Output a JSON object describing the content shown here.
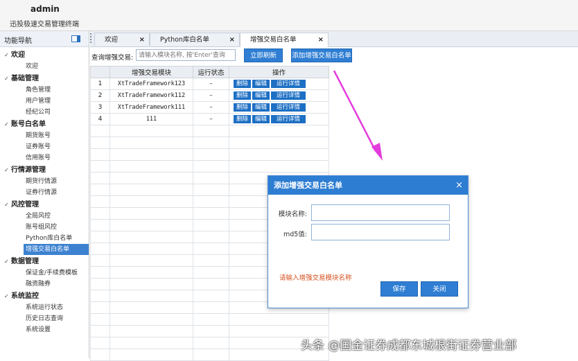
{
  "header": {
    "user": "admin",
    "system_name": "迅投极速交易管理终端"
  },
  "sidebar": {
    "title": "功能导航",
    "groups": [
      {
        "label": "欢迎",
        "items": [
          "欢迎"
        ]
      },
      {
        "label": "基础管理",
        "items": [
          "角色管理",
          "用户管理",
          "经纪公司"
        ]
      },
      {
        "label": "账号白名单",
        "items": [
          "期货账号",
          "证券账号",
          "信用账号"
        ]
      },
      {
        "label": "行情源管理",
        "items": [
          "期货行情源",
          "证券行情源"
        ]
      },
      {
        "label": "风控管理",
        "items": [
          "全局风控",
          "账号组风控",
          "Python库白名单",
          "增强交易白名单"
        ]
      },
      {
        "label": "数据管理",
        "items": [
          "保证金/手续费模板",
          "融资融券"
        ]
      },
      {
        "label": "系统监控",
        "items": [
          "系统运行状态",
          "历史日志查询",
          "系统设置"
        ]
      }
    ],
    "active_item": "增强交易白名单"
  },
  "tabs": [
    {
      "label": "欢迎"
    },
    {
      "label": "Python库白名单"
    },
    {
      "label": "增强交易白名单",
      "active": true
    }
  ],
  "toolbar": {
    "query_label": "查询增强交易:",
    "search_placeholder": "请输入模块名称, 按'Enter'查询",
    "refresh_button": "立即刷新",
    "add_button": "添加增强交易白名单"
  },
  "table": {
    "columns": [
      "增强交易模块",
      "运行状态",
      "操作"
    ],
    "rows": [
      {
        "index": "1",
        "module": "XtTradeFramework123",
        "status": "–"
      },
      {
        "index": "2",
        "module": "XtTradeFramework112",
        "status": "–"
      },
      {
        "index": "3",
        "module": "XtTradeFramework111",
        "status": "–"
      },
      {
        "index": "4",
        "module": "111",
        "status": "–"
      }
    ],
    "actions": {
      "delete": "删除",
      "edit": "编辑",
      "details": "运行详情"
    }
  },
  "dialog": {
    "title": "添加增强交易白名单",
    "close_icon": "×",
    "module_label": "模块名称:",
    "md5_label": "md5值:",
    "module_value": "",
    "md5_value": "",
    "hint": "请输入增强交易模块名称",
    "save_button": "保存",
    "cancel_button": "关闭"
  },
  "watermark": "头条 @国金证券成都东城根街证券营业部",
  "colors": {
    "accent": "#2f7ed3",
    "active_nav": "#3d82d0",
    "hint": "#d6501f",
    "arrow": "#e43cdc"
  }
}
